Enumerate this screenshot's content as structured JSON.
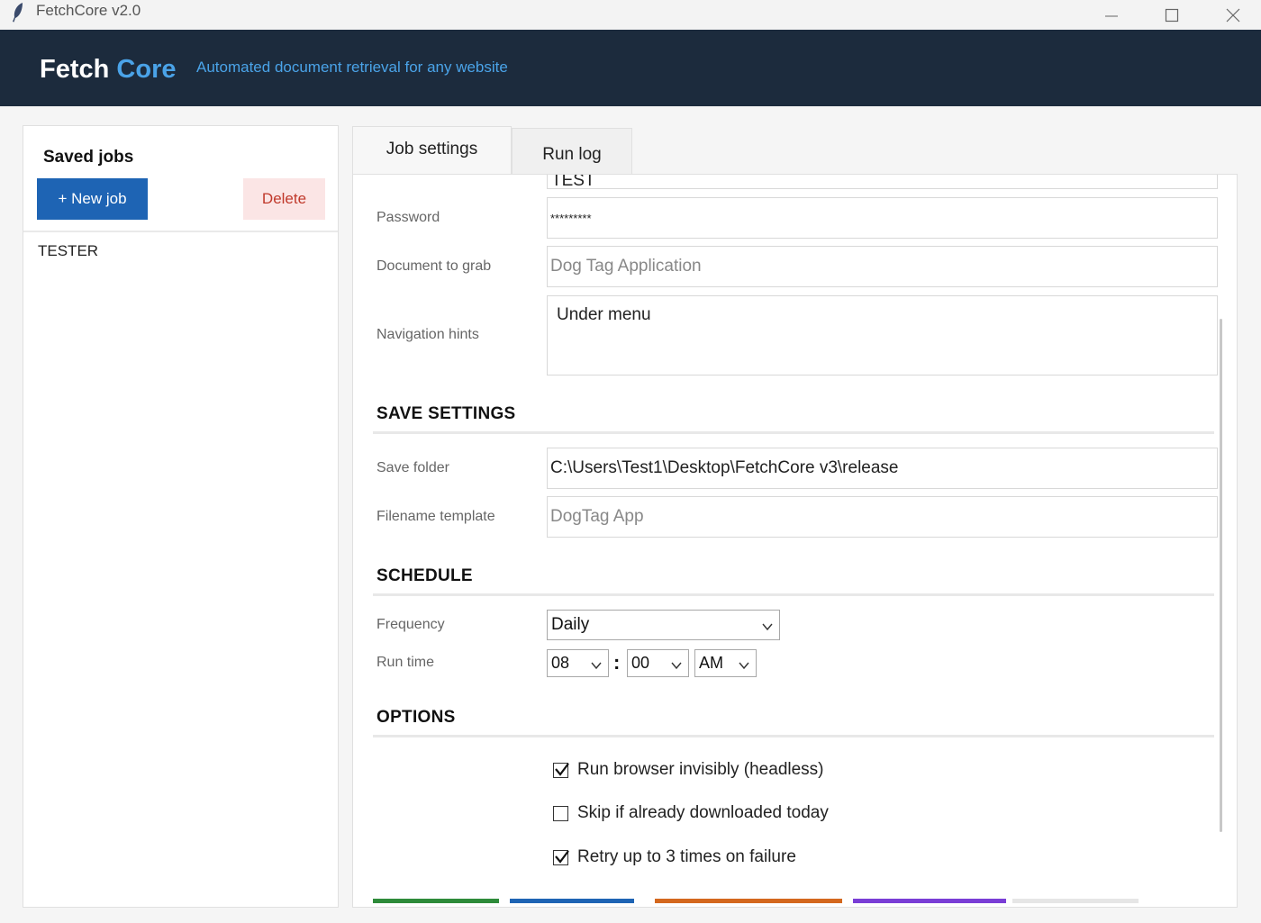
{
  "window": {
    "title": "FetchCore v2.0"
  },
  "header": {
    "brand_part1": "Fetch",
    "brand_part2": "Core",
    "tagline": "Automated document retrieval for any website"
  },
  "sidebar": {
    "title": "Saved jobs",
    "new_job_label": "+ New job",
    "delete_label": "Delete",
    "jobs": [
      "TESTER"
    ]
  },
  "tabs": [
    {
      "label": "Job settings",
      "active": true
    },
    {
      "label": "Run log",
      "active": false
    }
  ],
  "form": {
    "username_partial": "TEST",
    "password_label": "Password",
    "password_value": "*********",
    "document_label": "Document to grab",
    "document_value": "Dog Tag Application",
    "nav_hints_label": "Navigation hints",
    "nav_hints_value": "Under menu",
    "save_section": "SAVE SETTINGS",
    "save_folder_label": "Save folder",
    "save_folder_value": "C:\\Users\\Test1\\Desktop\\FetchCore v3\\release",
    "filename_label": "Filename template",
    "filename_value": "DogTag App",
    "schedule_section": "SCHEDULE",
    "frequency_label": "Frequency",
    "frequency_value": "Daily",
    "runtime_label": "Run time",
    "hour_value": "08",
    "minute_value": "00",
    "ampm_value": "AM",
    "time_separator": ":",
    "options_section": "OPTIONS",
    "options": [
      {
        "label": "Run browser invisibly (headless)",
        "checked": true
      },
      {
        "label": "Skip if already downloaded today",
        "checked": false
      },
      {
        "label": "Retry up to 3 times on failure",
        "checked": true
      }
    ]
  },
  "colors": {
    "header_bg": "#1c2b3d",
    "brand_accent": "#4aa3e8",
    "primary_button": "#1e64b4",
    "danger_bg": "#fbe5e5",
    "danger_text": "#c0392b",
    "bottom_bars": [
      "#2e8b3a",
      "#1e64b4",
      "#d4681e",
      "#7a3ed6",
      "#e6e6e6"
    ]
  },
  "icons": {
    "app": "feather-icon",
    "minimize": "minimize-icon",
    "maximize": "maximize-icon",
    "close": "close-icon",
    "dropdown": "chevron-down-icon",
    "check": "checkmark-icon"
  }
}
